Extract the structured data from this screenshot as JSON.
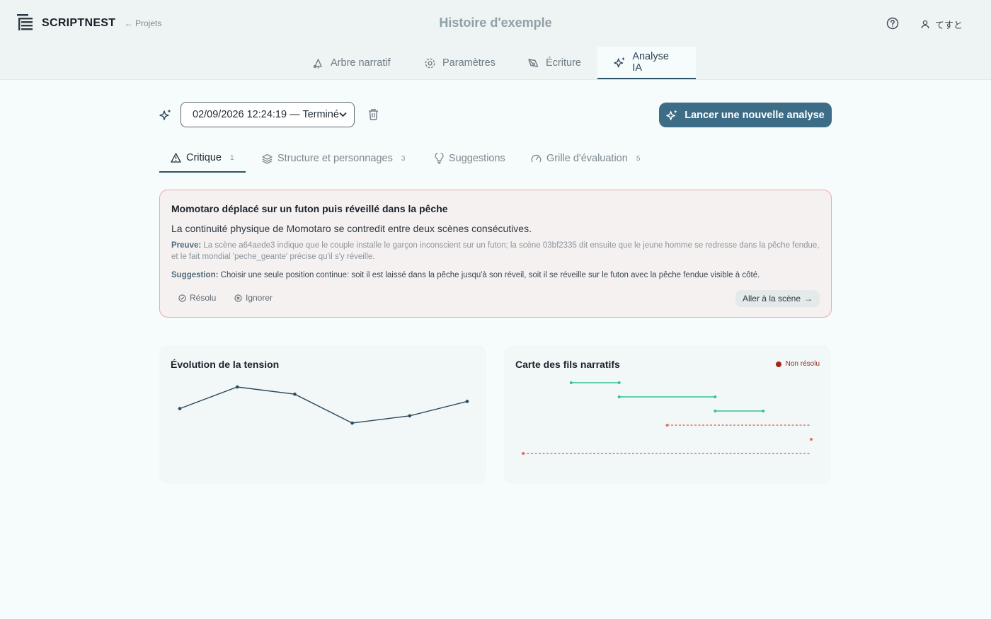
{
  "header": {
    "brand": "SCRIPTNEST",
    "back_label": "Projets",
    "title": "Histoire d'exemple",
    "user_name": "てすと"
  },
  "main_tabs": [
    {
      "label": "Arbre narratif",
      "icon": "tree-icon"
    },
    {
      "label": "Paramètres",
      "icon": "gear-icon"
    },
    {
      "label": "Écriture",
      "icon": "pen-icon"
    },
    {
      "label": "Analyse IA",
      "icon": "sparkle-icon",
      "active": true
    }
  ],
  "analysis": {
    "selected_run": "02/09/2026 12:24:19 — Terminé",
    "run_button": "Lancer une nouvelle analyse"
  },
  "sub_tabs": [
    {
      "label": "Critique",
      "count": "1",
      "icon": "warning-icon",
      "active": true
    },
    {
      "label": "Structure et personnages",
      "count": "3",
      "icon": "layers-icon"
    },
    {
      "label": "Suggestions",
      "count": "",
      "icon": "lightbulb-icon"
    },
    {
      "label": "Grille d'évaluation",
      "count": "5",
      "icon": "gauge-icon"
    }
  ],
  "issue": {
    "title": "Momotaro déplacé sur un futon puis réveillé dans la pêche",
    "description": "La continuité physique de Momotaro se contredit entre deux scènes consécutives.",
    "proof_label": "Preuve:",
    "proof_text": "La scène a64aede3 indique que le couple installe le garçon inconscient sur un futon; la scène 03bf2335 dit ensuite que le jeune homme se redresse dans la pêche fendue, et le fait mondial 'peche_geante' précise qu'il s'y réveille.",
    "suggestion_label": "Suggestion:",
    "suggestion_text": "Choisir une seule position continue: soit il est laissé dans la pêche jusqu'à son réveil, soit il se réveille sur le futon avec la pêche fendue visible à côté.",
    "resolve_label": "Résolu",
    "ignore_label": "Ignorer",
    "goto_label": "Aller à la scène"
  },
  "tension_panel": {
    "title": "Évolution de la tension"
  },
  "threads_panel": {
    "title": "Carte des fils narratifs",
    "legend_label": "Non résolu"
  },
  "colors": {
    "accent": "#3d6d86",
    "resolved": "#34c48f",
    "unresolved": "#e0706c",
    "line": "#2c4a5c"
  },
  "chart_data": [
    {
      "type": "line",
      "title": "Évolution de la tension",
      "x": [
        1,
        2,
        3,
        4,
        5,
        6
      ],
      "values": [
        3,
        6,
        5,
        1,
        2,
        4
      ]
    },
    {
      "type": "timeline",
      "title": "Carte des fils narratifs",
      "threads": [
        {
          "start": 2,
          "end": 3,
          "resolved": true
        },
        {
          "start": 3,
          "end": 5,
          "resolved": true
        },
        {
          "start": 5,
          "end": 6,
          "resolved": true
        },
        {
          "start": 4,
          "end": 7,
          "resolved": false
        },
        {
          "start": 7,
          "end": 7,
          "resolved": false
        },
        {
          "start": 1,
          "end": 7,
          "resolved": false
        }
      ]
    }
  ]
}
